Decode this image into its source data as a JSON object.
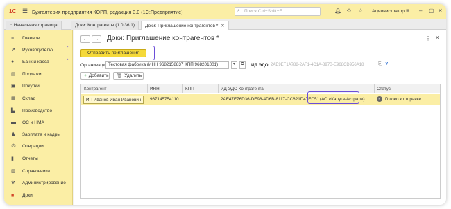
{
  "titlebar": {
    "logo": "1С",
    "app_title": "Бухгалтерия предприятия КОРП, редакция 3.0  (1С:Предприятие)",
    "search_placeholder": "Поиск Ctrl+Shift+F",
    "user": "Администратор"
  },
  "tabs": [
    {
      "label": "Начальная страница"
    },
    {
      "label": "Доки: Контрагенты (1.0.36.1)"
    },
    {
      "label": "Доки: Приглашение контрагентов *"
    }
  ],
  "sidebar": {
    "items": [
      {
        "label": "Главное",
        "icon": "menu-icon"
      },
      {
        "label": "Руководителю",
        "icon": "chart-up-icon"
      },
      {
        "label": "Банк и касса",
        "icon": "bank-icon"
      },
      {
        "label": "Продажи",
        "icon": "sales-icon"
      },
      {
        "label": "Покупки",
        "icon": "cart-icon"
      },
      {
        "label": "Склад",
        "icon": "warehouse-icon"
      },
      {
        "label": "Производство",
        "icon": "factory-icon"
      },
      {
        "label": "ОС и НМА",
        "icon": "truck-icon"
      },
      {
        "label": "Зарплата и кадры",
        "icon": "people-icon"
      },
      {
        "label": "Операции",
        "icon": "operations-icon"
      },
      {
        "label": "Отчеты",
        "icon": "bar-chart-icon"
      },
      {
        "label": "Справочники",
        "icon": "book-icon"
      },
      {
        "label": "Администрирование",
        "icon": "gear-icon"
      },
      {
        "label": "Доки",
        "icon": "docs-icon"
      }
    ]
  },
  "document": {
    "title": "Доки: Приглашение контрагентов *",
    "send_button": "Отправить приглашения",
    "org_label": "Организация:",
    "org_value": "Тестовая фабрика (ИНН 9682158837 КПП 968201001)",
    "edo_label": "ИД ЭДО:",
    "edo_value": "2AE9EF1A788-2AF1-4C1A-897B-E968CD956A18",
    "add_button": "Добавить",
    "delete_button": "Удалить"
  },
  "table": {
    "columns": [
      "Контрагент",
      "ИНН",
      "КПП",
      "ИД ЭДО Контрагента",
      "Статус"
    ],
    "rows": [
      {
        "counterparty": "ИП Иванов Иван Иванович",
        "inn": "967145754110",
        "kpp": "",
        "edo_id": "2AE47E76D36-DE98-4D6B-8117-CC621D47EC51",
        "edo_name": "(АО «Калуга-Астрал»)",
        "status": "Готово к отправке"
      }
    ]
  },
  "colors": {
    "accent_yellow": "#fbeea5",
    "button_yellow": "#f5d93a",
    "highlight": "#6b4ed8",
    "logo_red": "#d2452a"
  }
}
